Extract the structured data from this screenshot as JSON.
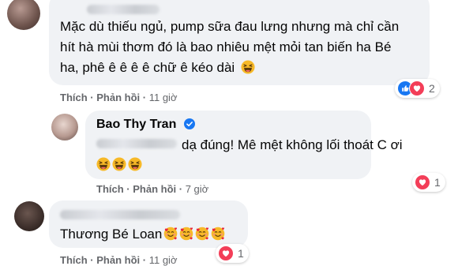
{
  "comment1": {
    "text_lines": [
      "Mặc dù thiếu ngủ, pump sữa đau lưng nhưng mà chỉ cần",
      "hít hà mùi thơm đó là bao nhiêu mệt mỏi tan biến ha Bé",
      "ha, phê ê ê ê ê chữ ê kéo dài"
    ],
    "emoji": "laughing-emoji",
    "like_label": "Thích",
    "reply_label": "Phản hồi",
    "time": "11 giờ",
    "reaction_count": "2",
    "reaction_icons": [
      "like-icon",
      "heart-icon"
    ]
  },
  "reply": {
    "author": "Bao Thy Tran",
    "verified": true,
    "text_line1": "dạ đúng! Mê mệt không lối thoát C ơi",
    "emojis": [
      "laughing-emoji",
      "laughing-emoji",
      "laughing-emoji"
    ],
    "like_label": "Thích",
    "reply_label": "Phản hồi",
    "time": "7 giờ",
    "reaction_count": "1",
    "reaction_icons": [
      "heart-icon"
    ]
  },
  "comment2": {
    "text": "Thương Bé Loan",
    "emojis": [
      "smiling-face-with-hearts-emoji",
      "smiling-face-with-hearts-emoji",
      "smiling-face-with-hearts-emoji",
      "smiling-face-with-hearts-emoji"
    ],
    "like_label": "Thích",
    "reply_label": "Phản hồi",
    "time": "11 giờ",
    "reaction_count": "1",
    "reaction_icons": [
      "heart-icon"
    ]
  },
  "colors": {
    "bubble": "#f0f2f5",
    "secondary_text": "#65676b",
    "like_blue": "#1877f2",
    "heart_red": "#f33e58",
    "verified_blue": "#1877f2"
  }
}
